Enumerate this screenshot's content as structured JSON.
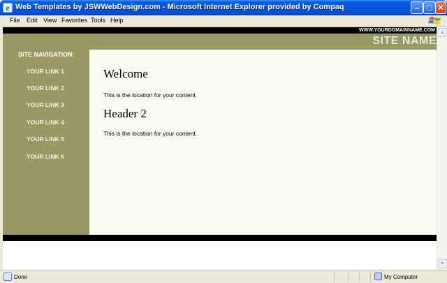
{
  "window": {
    "title": "Web Templates by JSWWebDesign.com - Microsoft Internet Explorer provided by Compaq",
    "app_icon": "e",
    "minimize": "–",
    "maximize": "□",
    "close": "✕"
  },
  "menu": [
    "File",
    "Edit",
    "View",
    "Favorites",
    "Tools",
    "Help"
  ],
  "page": {
    "domain": "WWW.YOURDOMAINNAME.COM",
    "site_name": "SITE NAME",
    "nav_heading": "SITE NAVIGATION:",
    "nav_links": [
      "YOUR LINK 1",
      "YOUR LINK 2",
      "YOUR LINK 3",
      "YOUR LINK 4",
      "YOUR LINK 5",
      "YOUR LINK 6"
    ],
    "heading1": "Welcome",
    "para1": "This is the location for your content.",
    "heading2": "Header 2",
    "para2": "This is the location for your content."
  },
  "status": {
    "text": "Done",
    "zone": "My Computer"
  },
  "colors": {
    "olive": "#999966",
    "content_bg": "#fafaf0",
    "band": "#000000"
  },
  "icons": {
    "scroll_up": "▲",
    "scroll_down": "▼"
  }
}
